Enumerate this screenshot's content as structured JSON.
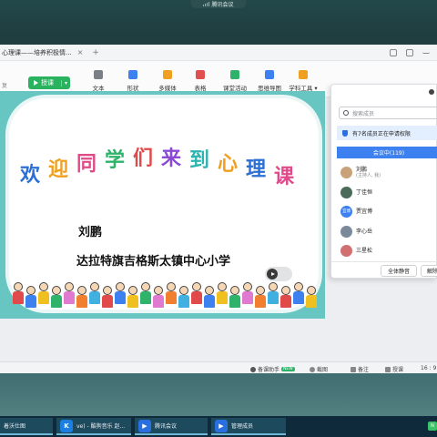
{
  "top_indicator": {
    "label": "腾讯会议"
  },
  "window": {
    "title": "心理课——培养积极情...",
    "tab_close": "×",
    "tab_add": "+"
  },
  "ribbon": {
    "undo_label": "复",
    "start_button": "授课",
    "start_caret": "▾",
    "tools": [
      {
        "label": "文本",
        "icon": "text-icon",
        "color": "#7a7f87"
      },
      {
        "label": "形状",
        "icon": "shape-icon",
        "color": "#3d81f0"
      },
      {
        "label": "多媒体",
        "icon": "media-icon",
        "color": "#f0a020"
      },
      {
        "label": "表格",
        "icon": "table-icon",
        "color": "#e05050"
      },
      {
        "label": "课堂活动",
        "icon": "activity-icon",
        "color": "#2fb36a"
      },
      {
        "label": "思维导图",
        "icon": "mindmap-icon",
        "color": "#3d81f0"
      },
      {
        "label": "学科工具 ▾",
        "icon": "subject-tools-icon",
        "color": "#f0a020"
      }
    ]
  },
  "slide": {
    "welcome_chars": [
      "欢",
      "迎",
      "同",
      "学",
      "们",
      "来",
      "到",
      "心",
      "理",
      "课"
    ],
    "welcome_colors": [
      "#2a6fd6",
      "#f0a020",
      "#e04a8a",
      "#2fb36a",
      "#e04a4a",
      "#8a4ad6",
      "#2fb3b0",
      "#f0a020",
      "#2a6fd6",
      "#e04a8a"
    ],
    "teacher_name": "刘鹏",
    "school": "达拉特旗吉格斯太镇中心小学"
  },
  "members_panel": {
    "search_placeholder": "搜索成员",
    "notice": "有7名成员正在申请权限",
    "tab_label": "会议中(119)",
    "members": [
      {
        "name": "刘鹏",
        "role": "(主持人, 我)",
        "avatar_text": "",
        "avatar_color": "#c9a27a"
      },
      {
        "name": "丁佳恒",
        "role": "",
        "avatar_text": "",
        "avatar_color": "#4a6a5a"
      },
      {
        "name": "贾宜博",
        "role": "",
        "avatar_text": "宜博",
        "avatar_color": "#3d81f0"
      },
      {
        "name": "李心岳",
        "role": "",
        "avatar_text": "",
        "avatar_color": "#7a8a9a"
      },
      {
        "name": "三星松",
        "role": "",
        "avatar_text": "",
        "avatar_color": "#d07070"
      }
    ],
    "mute_all": "全体静音",
    "unmute_all": "解除"
  },
  "statusbar": {
    "assistant": "备课助手",
    "new_badge": "NEW",
    "screenshot": "截图",
    "notes": "备注",
    "present": "授课",
    "ratio": "16 : 9"
  },
  "taskbar": {
    "items": [
      {
        "label": "着沃仕图",
        "icon_text": "",
        "icon_color": "#2a6fb0"
      },
      {
        "label": "ve) - 酷狗音乐 赵...",
        "icon_text": "K",
        "icon_color": "#1a7fe0"
      },
      {
        "label": "腾讯会议",
        "icon_text": "▶",
        "icon_color": "#2a6fe0"
      },
      {
        "label": "管理成员",
        "icon_text": "▶",
        "icon_color": "#2a6fe0"
      }
    ],
    "end_badge": "N"
  }
}
